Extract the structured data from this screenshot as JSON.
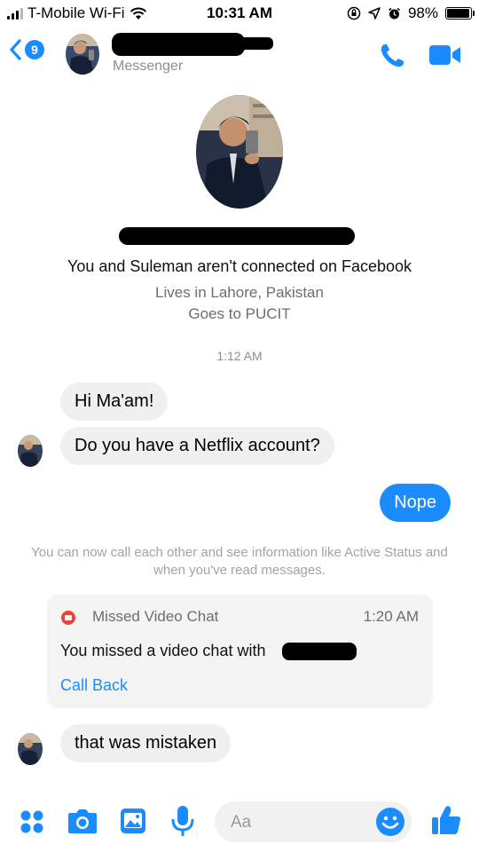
{
  "status_bar": {
    "carrier": "T-Mobile Wi-Fi",
    "time": "10:31 AM",
    "battery": "98%",
    "battery_level": 0.98
  },
  "header": {
    "unread_count": "9",
    "subtitle": "Messenger"
  },
  "profile": {
    "connection_note": "You and Suleman aren't connected on Facebook",
    "lives_in": "Lives in Lahore, Pakistan",
    "school": "Goes to PUCIT"
  },
  "conversation": {
    "timestamp": "1:12 AM",
    "messages": [
      {
        "from": "them",
        "text": "Hi Ma'am!"
      },
      {
        "from": "them",
        "text": "Do you have a Netflix account?"
      },
      {
        "from": "me",
        "text": "Nope"
      }
    ],
    "notice": "You can now call each other and see information like Active Status and when you've read messages.",
    "missed_call": {
      "title": "Missed Video Chat",
      "time": "1:20 AM",
      "body": "You missed a video chat with",
      "action": "Call Back"
    },
    "last_message": {
      "from": "them",
      "text": "that was mistaken"
    }
  },
  "composer": {
    "placeholder": "Aa"
  },
  "colors": {
    "accent": "#1a8cff",
    "bubble_gray": "#f0f0f0",
    "missed_red": "#e8453c"
  }
}
